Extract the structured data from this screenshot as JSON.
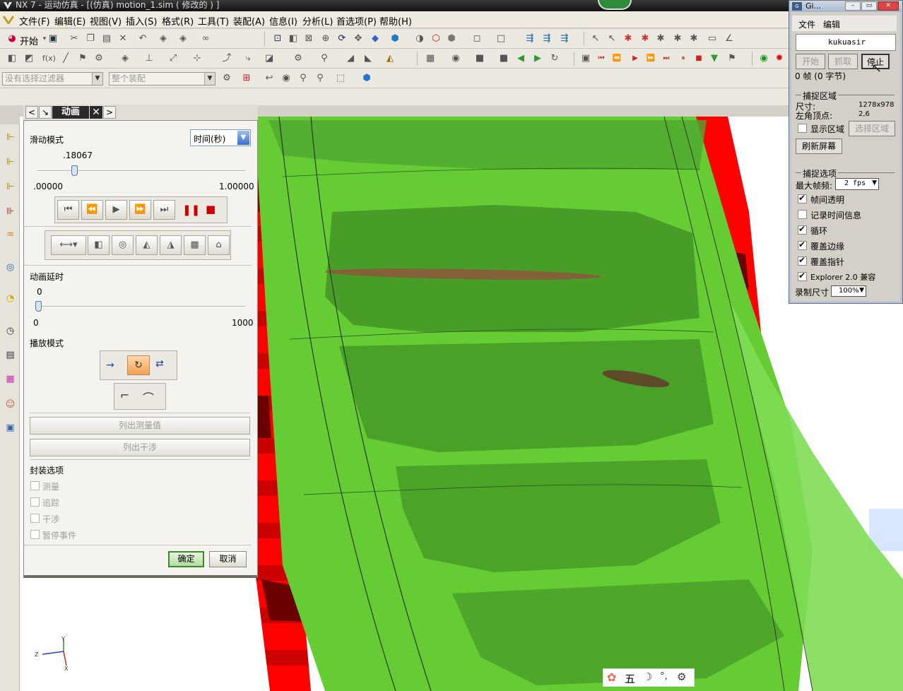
{
  "window": {
    "title": "NX 7 - 运动仿真 - [(仿真) motion_1.sim  ( 修改的 ) ]"
  },
  "menubar": [
    {
      "label": "文件(F)"
    },
    {
      "label": "编辑(E)"
    },
    {
      "label": "视图(V)"
    },
    {
      "label": "插入(S)"
    },
    {
      "label": "格式(R)"
    },
    {
      "label": "工具(T)"
    },
    {
      "label": "装配(A)"
    },
    {
      "label": "信息(I)"
    },
    {
      "label": "分析(L)"
    },
    {
      "label": "首选项(P)"
    },
    {
      "label": "帮助(H)"
    }
  ],
  "toolbar1": {
    "start_label": "开始"
  },
  "filter_bar": {
    "selection_filter": "没有选择过滤器",
    "assembly_scope": "整个装配"
  },
  "panel": {
    "title": "动画",
    "slide_mode_label": "滑动模式",
    "slide_mode_value": "时间(秒)",
    "time_slider": {
      "value": ".18067",
      "min": ".00000",
      "max": "1.00000",
      "fraction": 0.18067
    },
    "delay_label": "动画延时",
    "delay_slider": {
      "value": "0",
      "min": "0",
      "max": "1000",
      "fraction": 0
    },
    "playback_label": "播放模式",
    "list_measurements": "列出测量值",
    "list_interference": "列出干涉",
    "package_label": "封装选项",
    "options": [
      {
        "label": "测量"
      },
      {
        "label": "追踪"
      },
      {
        "label": "干涉"
      },
      {
        "label": "暂停事件"
      }
    ],
    "ok": "确定",
    "cancel": "取消"
  },
  "gif_tool": {
    "title": "Gi...",
    "menu": [
      "文件",
      "编辑"
    ],
    "user": "kukuasir",
    "buttons": {
      "start": "开始",
      "grab": "抓取",
      "stop": "停止"
    },
    "frames": "0 帧 (0 字节)",
    "capture_area": "捕捉区域",
    "size_label": "尺寸:",
    "size_value": "1278x978",
    "corner_label": "左角顶点:",
    "corner_value": "2,6",
    "show_area": "显示区域",
    "select_area": "选择区域",
    "refresh": "刷新屏幕",
    "capture_options": "捕捉选项",
    "max_fps_label": "最大帧频:",
    "max_fps_value": "2 fps",
    "checks": [
      {
        "label": "帧间透明",
        "checked": true
      },
      {
        "label": "记录时间信息",
        "checked": false
      },
      {
        "label": "循环",
        "checked": true
      },
      {
        "label": "覆盖边缘",
        "checked": true
      },
      {
        "label": "覆盖指针",
        "checked": true
      },
      {
        "label": "Explorer 2.0 兼容",
        "checked": true
      }
    ],
    "record_size_label": "录制尺寸",
    "record_size_value": "100%"
  },
  "axes": {
    "y": "Y",
    "z": "Z",
    "x": "X"
  },
  "ime": {
    "char": "五"
  },
  "colors": {
    "red": "#ff0000",
    "dark_red": "#6a0000",
    "green": "#66cc33",
    "dark_green": "#3e8e24"
  }
}
